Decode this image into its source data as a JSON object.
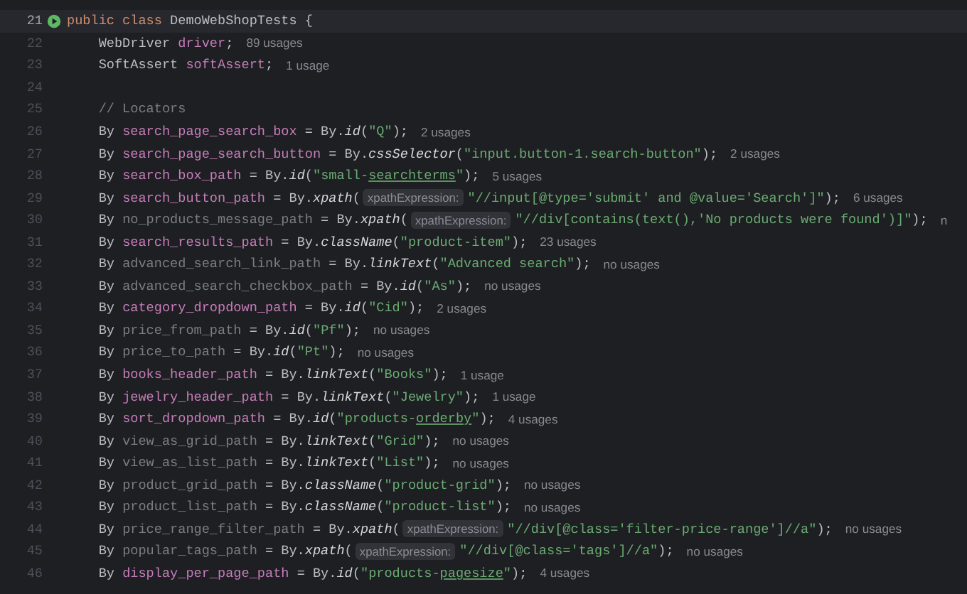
{
  "editor": {
    "lines": [
      {
        "number": "21",
        "current": true,
        "run_icon": true,
        "parts": [
          {
            "kind": "code",
            "tokens": [
              {
                "kind": "keyword",
                "text": "public class "
              },
              {
                "kind": "plain",
                "text": "DemoWebShopTests {"
              }
            ]
          }
        ]
      },
      {
        "number": "22",
        "parts": [
          {
            "kind": "code",
            "tokens": [
              {
                "kind": "plain",
                "text": "    WebDriver "
              },
              {
                "kind": "field",
                "text": "driver"
              },
              {
                "kind": "plain",
                "text": ";"
              }
            ]
          }
        ],
        "usages": "89 usages"
      },
      {
        "number": "23",
        "parts": [
          {
            "kind": "code",
            "tokens": [
              {
                "kind": "plain",
                "text": "    SoftAssert "
              },
              {
                "kind": "field",
                "text": "softAssert"
              },
              {
                "kind": "plain",
                "text": ";"
              }
            ]
          }
        ],
        "usages": "1 usage"
      },
      {
        "number": "24"
      },
      {
        "number": "25",
        "parts": [
          {
            "kind": "code",
            "tokens": [
              {
                "kind": "comment",
                "text": "    // Locators"
              }
            ]
          }
        ]
      },
      {
        "number": "26",
        "parts": [
          {
            "kind": "code",
            "tokens": [
              {
                "kind": "plain",
                "text": "    By "
              },
              {
                "kind": "field",
                "text": "search_page_search_box"
              },
              {
                "kind": "plain",
                "text": " = By."
              },
              {
                "kind": "call",
                "text": "id"
              },
              {
                "kind": "plain",
                "text": "("
              },
              {
                "kind": "string",
                "text": "\"Q\""
              },
              {
                "kind": "plain",
                "text": ");"
              }
            ]
          }
        ],
        "usages": "2 usages"
      },
      {
        "number": "27",
        "parts": [
          {
            "kind": "code",
            "tokens": [
              {
                "kind": "plain",
                "text": "    By "
              },
              {
                "kind": "field",
                "text": "search_page_search_button"
              },
              {
                "kind": "plain",
                "text": " = By."
              },
              {
                "kind": "call",
                "text": "cssSelector"
              },
              {
                "kind": "plain",
                "text": "("
              },
              {
                "kind": "string",
                "text": "\"input.button-1.search-button\""
              },
              {
                "kind": "plain",
                "text": ");"
              }
            ]
          }
        ],
        "usages": "2 usages"
      },
      {
        "number": "28",
        "parts": [
          {
            "kind": "code",
            "tokens": [
              {
                "kind": "plain",
                "text": "    By "
              },
              {
                "kind": "field",
                "text": "search_box_path"
              },
              {
                "kind": "plain",
                "text": " = By."
              },
              {
                "kind": "call",
                "text": "id"
              },
              {
                "kind": "plain",
                "text": "("
              },
              {
                "kind": "string",
                "text": "\"small-"
              },
              {
                "kind": "typo",
                "text": "searchterms"
              },
              {
                "kind": "string",
                "text": "\""
              },
              {
                "kind": "plain",
                "text": ");"
              }
            ]
          }
        ],
        "usages": "5 usages"
      },
      {
        "number": "29",
        "parts": [
          {
            "kind": "code",
            "tokens": [
              {
                "kind": "plain",
                "text": "    By "
              },
              {
                "kind": "field",
                "text": "search_button_path"
              },
              {
                "kind": "plain",
                "text": " = By."
              },
              {
                "kind": "call",
                "text": "xpath"
              },
              {
                "kind": "plain",
                "text": "("
              }
            ]
          },
          {
            "kind": "hint",
            "text": "xpathExpression:"
          },
          {
            "kind": "code",
            "tokens": [
              {
                "kind": "string",
                "text": "\"//input[@type='submit' and @value='Search']\""
              },
              {
                "kind": "plain",
                "text": ");"
              }
            ]
          }
        ],
        "usages": "6 usages"
      },
      {
        "number": "30",
        "parts": [
          {
            "kind": "code",
            "tokens": [
              {
                "kind": "plain",
                "text": "    By "
              },
              {
                "kind": "unused",
                "text": "no_products_message_path"
              },
              {
                "kind": "plain",
                "text": " = By."
              },
              {
                "kind": "call",
                "text": "xpath"
              },
              {
                "kind": "plain",
                "text": "("
              }
            ]
          },
          {
            "kind": "hint",
            "text": "xpathExpression:"
          },
          {
            "kind": "code",
            "tokens": [
              {
                "kind": "string",
                "text": "\"//div[contains(text(),'No products were found')]\""
              },
              {
                "kind": "plain",
                "text": ");"
              }
            ]
          }
        ],
        "usages": "n"
      },
      {
        "number": "31",
        "parts": [
          {
            "kind": "code",
            "tokens": [
              {
                "kind": "plain",
                "text": "    By "
              },
              {
                "kind": "field",
                "text": "search_results_path"
              },
              {
                "kind": "plain",
                "text": " = By."
              },
              {
                "kind": "call",
                "text": "className"
              },
              {
                "kind": "plain",
                "text": "("
              },
              {
                "kind": "string",
                "text": "\"product-item\""
              },
              {
                "kind": "plain",
                "text": ");"
              }
            ]
          }
        ],
        "usages": "23 usages"
      },
      {
        "number": "32",
        "parts": [
          {
            "kind": "code",
            "tokens": [
              {
                "kind": "plain",
                "text": "    By "
              },
              {
                "kind": "unused",
                "text": "advanced_search_link_path"
              },
              {
                "kind": "plain",
                "text": " = By."
              },
              {
                "kind": "call",
                "text": "linkText"
              },
              {
                "kind": "plain",
                "text": "("
              },
              {
                "kind": "string",
                "text": "\"Advanced search\""
              },
              {
                "kind": "plain",
                "text": ");"
              }
            ]
          }
        ],
        "usages": "no usages"
      },
      {
        "number": "33",
        "parts": [
          {
            "kind": "code",
            "tokens": [
              {
                "kind": "plain",
                "text": "    By "
              },
              {
                "kind": "unused",
                "text": "advanced_search_checkbox_path"
              },
              {
                "kind": "plain",
                "text": " = By."
              },
              {
                "kind": "call",
                "text": "id"
              },
              {
                "kind": "plain",
                "text": "("
              },
              {
                "kind": "string",
                "text": "\"As\""
              },
              {
                "kind": "plain",
                "text": ");"
              }
            ]
          }
        ],
        "usages": "no usages"
      },
      {
        "number": "34",
        "parts": [
          {
            "kind": "code",
            "tokens": [
              {
                "kind": "plain",
                "text": "    By "
              },
              {
                "kind": "field",
                "text": "category_dropdown_path"
              },
              {
                "kind": "plain",
                "text": " = By."
              },
              {
                "kind": "call",
                "text": "id"
              },
              {
                "kind": "plain",
                "text": "("
              },
              {
                "kind": "string",
                "text": "\"Cid\""
              },
              {
                "kind": "plain",
                "text": ");"
              }
            ]
          }
        ],
        "usages": "2 usages"
      },
      {
        "number": "35",
        "parts": [
          {
            "kind": "code",
            "tokens": [
              {
                "kind": "plain",
                "text": "    By "
              },
              {
                "kind": "unused",
                "text": "price_from_path"
              },
              {
                "kind": "plain",
                "text": " = By."
              },
              {
                "kind": "call",
                "text": "id"
              },
              {
                "kind": "plain",
                "text": "("
              },
              {
                "kind": "string",
                "text": "\"Pf\""
              },
              {
                "kind": "plain",
                "text": ");"
              }
            ]
          }
        ],
        "usages": "no usages"
      },
      {
        "number": "36",
        "parts": [
          {
            "kind": "code",
            "tokens": [
              {
                "kind": "plain",
                "text": "    By "
              },
              {
                "kind": "unused",
                "text": "price_to_path"
              },
              {
                "kind": "plain",
                "text": " = By."
              },
              {
                "kind": "call",
                "text": "id"
              },
              {
                "kind": "plain",
                "text": "("
              },
              {
                "kind": "string",
                "text": "\"Pt\""
              },
              {
                "kind": "plain",
                "text": ");"
              }
            ]
          }
        ],
        "usages": "no usages"
      },
      {
        "number": "37",
        "parts": [
          {
            "kind": "code",
            "tokens": [
              {
                "kind": "plain",
                "text": "    By "
              },
              {
                "kind": "field",
                "text": "books_header_path"
              },
              {
                "kind": "plain",
                "text": " = By."
              },
              {
                "kind": "call",
                "text": "linkText"
              },
              {
                "kind": "plain",
                "text": "("
              },
              {
                "kind": "string",
                "text": "\"Books\""
              },
              {
                "kind": "plain",
                "text": ");"
              }
            ]
          }
        ],
        "usages": "1 usage"
      },
      {
        "number": "38",
        "parts": [
          {
            "kind": "code",
            "tokens": [
              {
                "kind": "plain",
                "text": "    By "
              },
              {
                "kind": "field",
                "text": "jewelry_header_path"
              },
              {
                "kind": "plain",
                "text": " = By."
              },
              {
                "kind": "call",
                "text": "linkText"
              },
              {
                "kind": "plain",
                "text": "("
              },
              {
                "kind": "string",
                "text": "\"Jewelry\""
              },
              {
                "kind": "plain",
                "text": ");"
              }
            ]
          }
        ],
        "usages": "1 usage"
      },
      {
        "number": "39",
        "parts": [
          {
            "kind": "code",
            "tokens": [
              {
                "kind": "plain",
                "text": "    By "
              },
              {
                "kind": "field",
                "text": "sort_dropdown_path"
              },
              {
                "kind": "plain",
                "text": " = By."
              },
              {
                "kind": "call",
                "text": "id"
              },
              {
                "kind": "plain",
                "text": "("
              },
              {
                "kind": "string",
                "text": "\"products-"
              },
              {
                "kind": "typo",
                "text": "orderby"
              },
              {
                "kind": "string",
                "text": "\""
              },
              {
                "kind": "plain",
                "text": ");"
              }
            ]
          }
        ],
        "usages": "4 usages"
      },
      {
        "number": "40",
        "parts": [
          {
            "kind": "code",
            "tokens": [
              {
                "kind": "plain",
                "text": "    By "
              },
              {
                "kind": "unused",
                "text": "view_as_grid_path"
              },
              {
                "kind": "plain",
                "text": " = By."
              },
              {
                "kind": "call",
                "text": "linkText"
              },
              {
                "kind": "plain",
                "text": "("
              },
              {
                "kind": "string",
                "text": "\"Grid\""
              },
              {
                "kind": "plain",
                "text": ");"
              }
            ]
          }
        ],
        "usages": "no usages"
      },
      {
        "number": "41",
        "parts": [
          {
            "kind": "code",
            "tokens": [
              {
                "kind": "plain",
                "text": "    By "
              },
              {
                "kind": "unused",
                "text": "view_as_list_path"
              },
              {
                "kind": "plain",
                "text": " = By."
              },
              {
                "kind": "call",
                "text": "linkText"
              },
              {
                "kind": "plain",
                "text": "("
              },
              {
                "kind": "string",
                "text": "\"List\""
              },
              {
                "kind": "plain",
                "text": ");"
              }
            ]
          }
        ],
        "usages": "no usages"
      },
      {
        "number": "42",
        "parts": [
          {
            "kind": "code",
            "tokens": [
              {
                "kind": "plain",
                "text": "    By "
              },
              {
                "kind": "unused",
                "text": "product_grid_path"
              },
              {
                "kind": "plain",
                "text": " = By."
              },
              {
                "kind": "call",
                "text": "className"
              },
              {
                "kind": "plain",
                "text": "("
              },
              {
                "kind": "string",
                "text": "\"product-grid\""
              },
              {
                "kind": "plain",
                "text": ");"
              }
            ]
          }
        ],
        "usages": "no usages"
      },
      {
        "number": "43",
        "parts": [
          {
            "kind": "code",
            "tokens": [
              {
                "kind": "plain",
                "text": "    By "
              },
              {
                "kind": "unused",
                "text": "product_list_path"
              },
              {
                "kind": "plain",
                "text": " = By."
              },
              {
                "kind": "call",
                "text": "className"
              },
              {
                "kind": "plain",
                "text": "("
              },
              {
                "kind": "string",
                "text": "\"product-list\""
              },
              {
                "kind": "plain",
                "text": ");"
              }
            ]
          }
        ],
        "usages": "no usages"
      },
      {
        "number": "44",
        "parts": [
          {
            "kind": "code",
            "tokens": [
              {
                "kind": "plain",
                "text": "    By "
              },
              {
                "kind": "unused",
                "text": "price_range_filter_path"
              },
              {
                "kind": "plain",
                "text": " = By."
              },
              {
                "kind": "call",
                "text": "xpath"
              },
              {
                "kind": "plain",
                "text": "("
              }
            ]
          },
          {
            "kind": "hint",
            "text": "xpathExpression:"
          },
          {
            "kind": "code",
            "tokens": [
              {
                "kind": "string",
                "text": "\"//div[@class='filter-price-range']//a\""
              },
              {
                "kind": "plain",
                "text": ");"
              }
            ]
          }
        ],
        "usages": "no usages"
      },
      {
        "number": "45",
        "parts": [
          {
            "kind": "code",
            "tokens": [
              {
                "kind": "plain",
                "text": "    By "
              },
              {
                "kind": "unused",
                "text": "popular_tags_path"
              },
              {
                "kind": "plain",
                "text": " = By."
              },
              {
                "kind": "call",
                "text": "xpath"
              },
              {
                "kind": "plain",
                "text": "("
              }
            ]
          },
          {
            "kind": "hint",
            "text": "xpathExpression:"
          },
          {
            "kind": "code",
            "tokens": [
              {
                "kind": "string",
                "text": "\"//div[@class='tags']//a\""
              },
              {
                "kind": "plain",
                "text": ");"
              }
            ]
          }
        ],
        "usages": "no usages"
      },
      {
        "number": "46",
        "parts": [
          {
            "kind": "code",
            "tokens": [
              {
                "kind": "plain",
                "text": "    By "
              },
              {
                "kind": "field",
                "text": "display_per_page_path"
              },
              {
                "kind": "plain",
                "text": " = By."
              },
              {
                "kind": "call",
                "text": "id"
              },
              {
                "kind": "plain",
                "text": "("
              },
              {
                "kind": "string",
                "text": "\"products-"
              },
              {
                "kind": "typo",
                "text": "pagesize"
              },
              {
                "kind": "string",
                "text": "\""
              },
              {
                "kind": "plain",
                "text": ");"
              }
            ]
          }
        ],
        "usages": "4 usages"
      }
    ]
  }
}
